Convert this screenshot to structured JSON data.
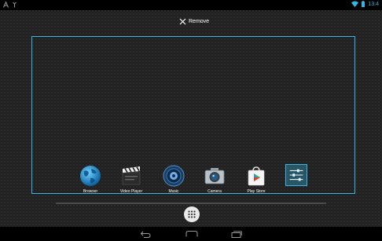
{
  "status_bar": {
    "left_icons": [
      "notification-a-icon",
      "notification-signal-icon"
    ],
    "right_icons": [
      "wifi-icon",
      "battery-icon"
    ],
    "time": "13:4"
  },
  "drop_target": {
    "icon": "close-icon",
    "label": "Remove"
  },
  "apps": [
    {
      "label": "Browser",
      "icon": "globe-icon"
    },
    {
      "label": "Video Player",
      "icon": "clapperboard-icon"
    },
    {
      "label": "Music",
      "icon": "speaker-icon"
    },
    {
      "label": "Camera",
      "icon": "camera-icon"
    },
    {
      "label": "Play Store",
      "icon": "play-store-bag-icon"
    },
    {
      "label": "",
      "icon": "settings-sliders-icon",
      "selected": true
    }
  ],
  "hotseat": {
    "icon": "all-apps-grid-icon"
  },
  "nav": {
    "icons": [
      "back-icon",
      "home-icon",
      "recent-apps-icon"
    ]
  },
  "colors": {
    "accent": "#33b5e5",
    "status_bar": "#000000",
    "nav_bar": "#000000"
  }
}
